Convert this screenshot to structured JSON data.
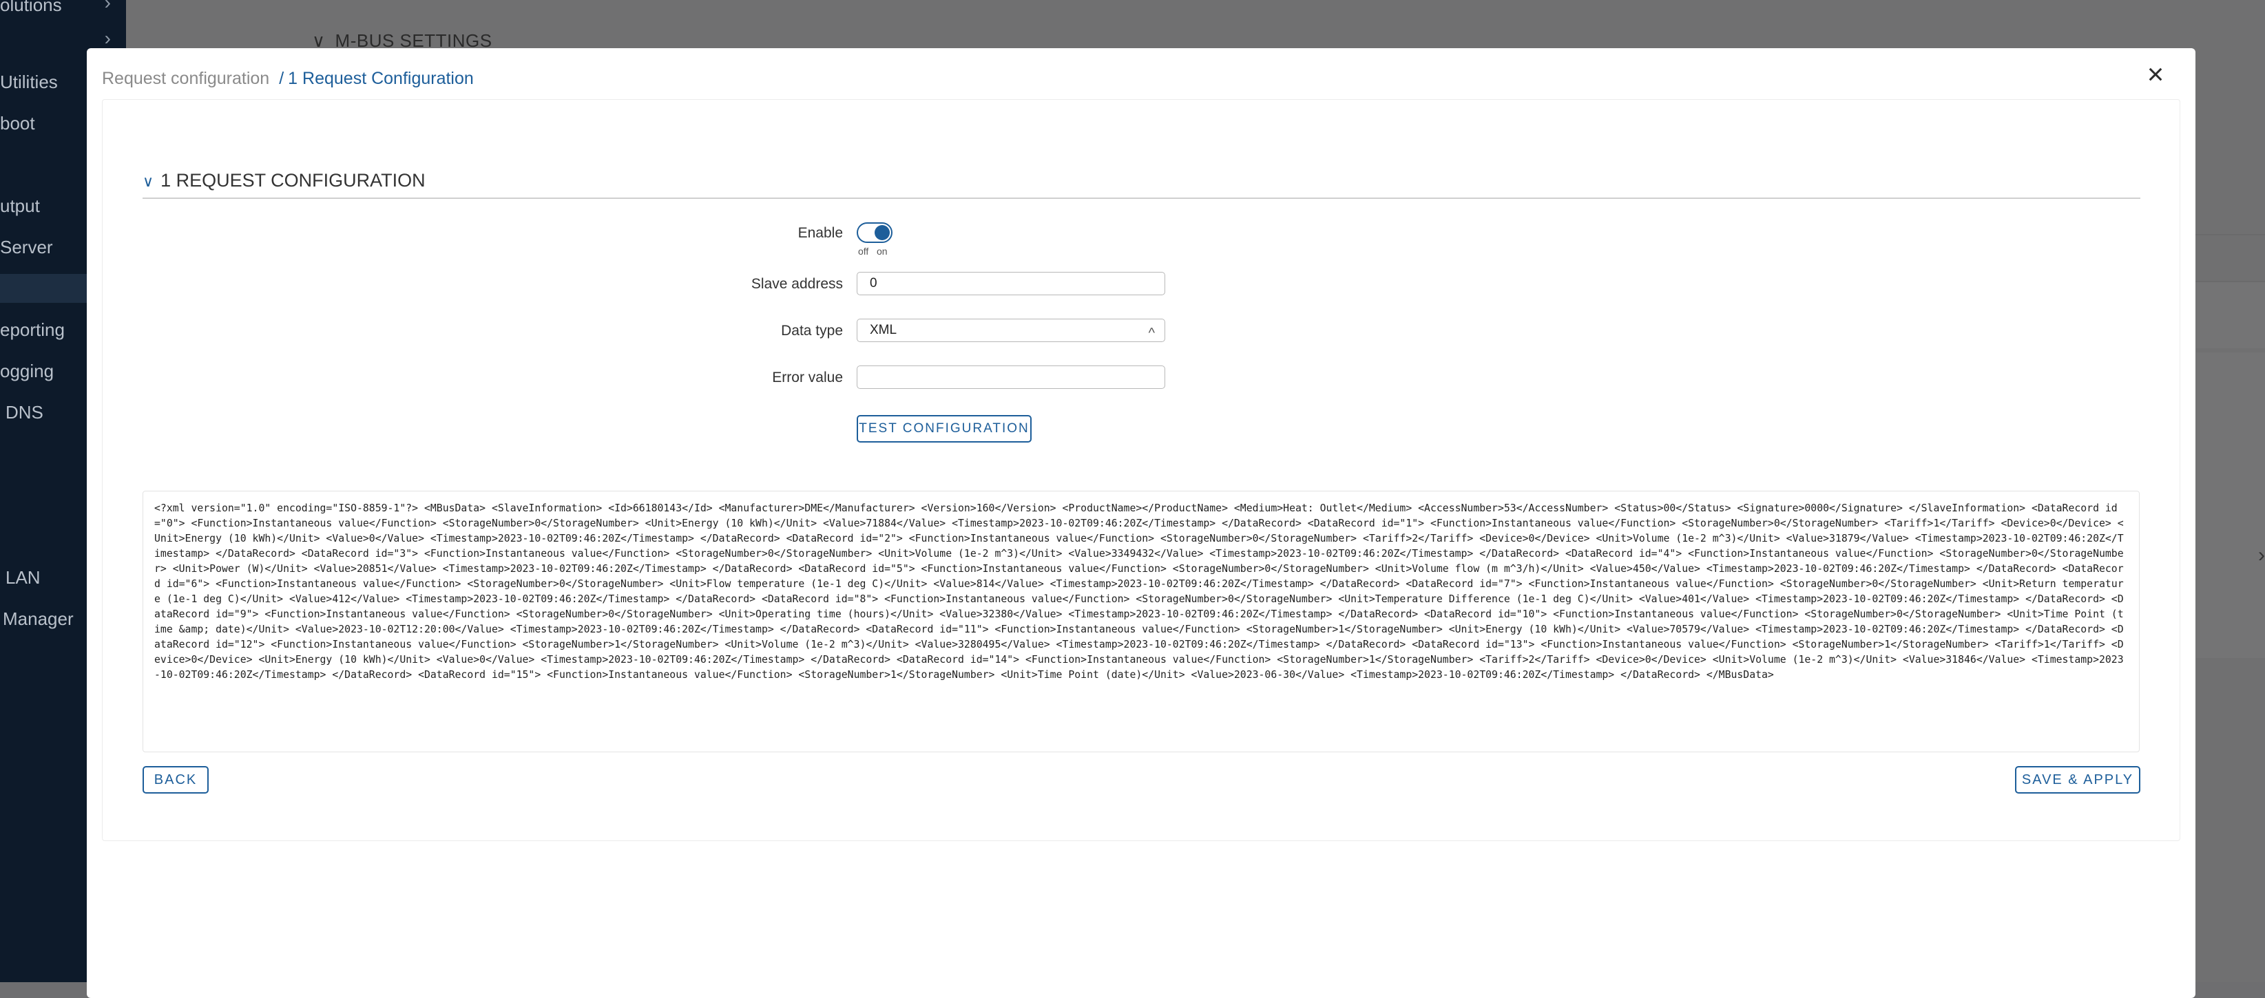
{
  "sidebar": {
    "items": [
      {
        "label": "olutions",
        "arrow": "›"
      },
      {
        "label": "",
        "arrow": "›"
      },
      {
        "label": "Utilities",
        "arrow": "›"
      },
      {
        "label": "boot",
        "arrow": ""
      },
      {
        "label": "utput",
        "arrow": ""
      },
      {
        "label": "Server",
        "arrow": ""
      },
      {
        "label": "",
        "arrow": ""
      },
      {
        "label": "eporting",
        "arrow": ""
      },
      {
        "label": "ogging",
        "arrow": ""
      },
      {
        "label": "DNS",
        "arrow": ""
      },
      {
        "label": "LAN",
        "arrow": ""
      },
      {
        "label": "Manager",
        "arrow": ""
      }
    ]
  },
  "background": {
    "section_title": "M-BUS SETTINGS",
    "right_arrow": "›"
  },
  "modal": {
    "breadcrumb_parent": "Request configuration",
    "breadcrumb_separator": "/",
    "breadcrumb_current": "1 Request Configuration",
    "close_icon": "×",
    "section_title": "1 REQUEST CONFIGURATION",
    "section_chevron": "∨",
    "form": {
      "enable_label": "Enable",
      "enable_value": "on",
      "toggle_off": "off",
      "toggle_on": "on",
      "slave_address_label": "Slave address",
      "slave_address_value": "0",
      "data_type_label": "Data type",
      "data_type_value": "XML",
      "data_type_arrow": "^",
      "error_value_label": "Error value",
      "error_value_value": ""
    },
    "test_button": "TEST CONFIGURATION",
    "xml_output": "<?xml version=\"1.0\" encoding=\"ISO-8859-1\"?> <MBusData> <SlaveInformation> <Id>66180143</Id> <Manufacturer>DME</Manufacturer> <Version>160</Version> <ProductName></ProductName> <Medium>Heat: Outlet</Medium> <AccessNumber>53</AccessNumber> <Status>00</Status> <Signature>0000</Signature> </SlaveInformation> <DataRecord id=\"0\"> <Function>Instantaneous value</Function> <StorageNumber>0</StorageNumber> <Unit>Energy (10 kWh)</Unit> <Value>71884</Value> <Timestamp>2023-10-02T09:46:20Z</Timestamp> </DataRecord> <DataRecord id=\"1\"> <Function>Instantaneous value</Function> <StorageNumber>0</StorageNumber> <Tariff>1</Tariff> <Device>0</Device> <Unit>Energy (10 kWh)</Unit> <Value>0</Value> <Timestamp>2023-10-02T09:46:20Z</Timestamp> </DataRecord> <DataRecord id=\"2\"> <Function>Instantaneous value</Function> <StorageNumber>0</StorageNumber> <Tariff>2</Tariff> <Device>0</Device> <Unit>Volume (1e-2 m^3)</Unit> <Value>31879</Value> <Timestamp>2023-10-02T09:46:20Z</Timestamp> </DataRecord> <DataRecord id=\"3\"> <Function>Instantaneous value</Function> <StorageNumber>0</StorageNumber> <Unit>Volume (1e-2 m^3)</Unit> <Value>3349432</Value> <Timestamp>2023-10-02T09:46:20Z</Timestamp> </DataRecord> <DataRecord id=\"4\"> <Function>Instantaneous value</Function> <StorageNumber>0</StorageNumber> <Unit>Power (W)</Unit> <Value>20851</Value> <Timestamp>2023-10-02T09:46:20Z</Timestamp> </DataRecord> <DataRecord id=\"5\"> <Function>Instantaneous value</Function> <StorageNumber>0</StorageNumber> <Unit>Volume flow (m m^3/h)</Unit> <Value>450</Value> <Timestamp>2023-10-02T09:46:20Z</Timestamp> </DataRecord> <DataRecord id=\"6\"> <Function>Instantaneous value</Function> <StorageNumber>0</StorageNumber> <Unit>Flow temperature (1e-1 deg C)</Unit> <Value>814</Value> <Timestamp>2023-10-02T09:46:20Z</Timestamp> </DataRecord> <DataRecord id=\"7\"> <Function>Instantaneous value</Function> <StorageNumber>0</StorageNumber> <Unit>Return temperature (1e-1 deg C)</Unit> <Value>412</Value> <Timestamp>2023-10-02T09:46:20Z</Timestamp> </DataRecord> <DataRecord id=\"8\"> <Function>Instantaneous value</Function> <StorageNumber>0</StorageNumber> <Unit>Temperature Difference (1e-1 deg C)</Unit> <Value>401</Value> <Timestamp>2023-10-02T09:46:20Z</Timestamp> </DataRecord> <DataRecord id=\"9\"> <Function>Instantaneous value</Function> <StorageNumber>0</StorageNumber> <Unit>Operating time (hours)</Unit> <Value>32380</Value> <Timestamp>2023-10-02T09:46:20Z</Timestamp> </DataRecord> <DataRecord id=\"10\"> <Function>Instantaneous value</Function> <StorageNumber>0</StorageNumber> <Unit>Time Point (time &amp; date)</Unit> <Value>2023-10-02T12:20:00</Value> <Timestamp>2023-10-02T09:46:20Z</Timestamp> </DataRecord> <DataRecord id=\"11\"> <Function>Instantaneous value</Function> <StorageNumber>1</StorageNumber> <Unit>Energy (10 kWh)</Unit> <Value>70579</Value> <Timestamp>2023-10-02T09:46:20Z</Timestamp> </DataRecord> <DataRecord id=\"12\"> <Function>Instantaneous value</Function> <StorageNumber>1</StorageNumber> <Unit>Volume (1e-2 m^3)</Unit> <Value>3280495</Value> <Timestamp>2023-10-02T09:46:20Z</Timestamp> </DataRecord> <DataRecord id=\"13\"> <Function>Instantaneous value</Function> <StorageNumber>1</StorageNumber> <Tariff>1</Tariff> <Device>0</Device> <Unit>Energy (10 kWh)</Unit> <Value>0</Value> <Timestamp>2023-10-02T09:46:20Z</Timestamp> </DataRecord> <DataRecord id=\"14\"> <Function>Instantaneous value</Function> <StorageNumber>1</StorageNumber> <Tariff>2</Tariff> <Device>0</Device> <Unit>Volume (1e-2 m^3)</Unit> <Value>31846</Value> <Timestamp>2023-10-02T09:46:20Z</Timestamp> </DataRecord> <DataRecord id=\"15\"> <Function>Instantaneous value</Function> <StorageNumber>1</StorageNumber> <Unit>Time Point (date)</Unit> <Value>2023-06-30</Value> <Timestamp>2023-10-02T09:46:20Z</Timestamp> </DataRecord> </MBusData>",
    "back_button": "BACK",
    "save_button": "SAVE & APPLY"
  },
  "colors": {
    "accent": "#1d5e9a",
    "sidebar_bg": "#0d1a2a",
    "overlay_bg": "#6e6e70"
  }
}
